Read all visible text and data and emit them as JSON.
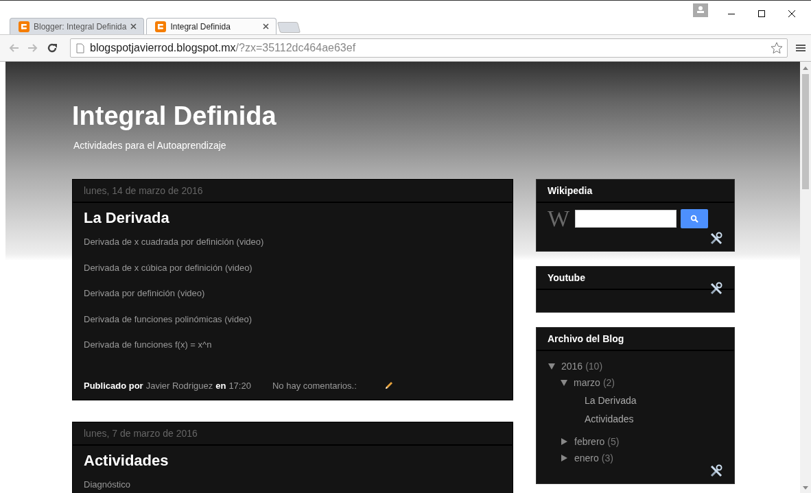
{
  "tabs": [
    {
      "title": "Blogger: Integral Definida",
      "selected": false
    },
    {
      "title": "Integral Definida",
      "selected": true
    }
  ],
  "address": {
    "host": "blogspotjavierrod.blogspot.mx",
    "path": "/?zx=35112dc464ae63ef"
  },
  "blog": {
    "title": "Integral Definida",
    "description": "Actividades para el Autoaprendizaje"
  },
  "posts": [
    {
      "date": "lunes, 14 de marzo de 2016",
      "title": "La Derivada",
      "lines": [
        "Derivada de x cuadrada por definición (video)",
        "Derivada de x cúbica por definición (video)",
        "Derivada por definición (video)",
        "Derivada de funciones polinómicas (video)",
        "Derivada de funciones f(x) = x^n"
      ],
      "footer": {
        "posted_by": "Publicado por",
        "author": "Javier Rodriguez",
        "at": "en",
        "time": "17:20",
        "comments": "No hay comentarios.:"
      }
    },
    {
      "date": "lunes, 7 de marzo de 2016",
      "title": "Actividades",
      "lines": [
        "Diagnóstico"
      ]
    }
  ],
  "sidebar": [
    {
      "kind": "wikipedia",
      "title": "Wikipedia",
      "logo": "W"
    },
    {
      "kind": "youtube",
      "title": "Youtube"
    },
    {
      "kind": "archive",
      "title": "Archivo del Blog",
      "tree": [
        {
          "label": "2016",
          "count": "(10)",
          "expanded": true,
          "children": [
            {
              "label": "marzo",
              "count": "(2)",
              "expanded": true,
              "children": [
                {
                  "label": "La Derivada"
                },
                {
                  "label": "Actividades"
                }
              ]
            },
            {
              "label": "febrero",
              "count": "(5)",
              "expanded": false
            },
            {
              "label": "enero",
              "count": "(3)",
              "expanded": false
            }
          ]
        }
      ]
    }
  ]
}
